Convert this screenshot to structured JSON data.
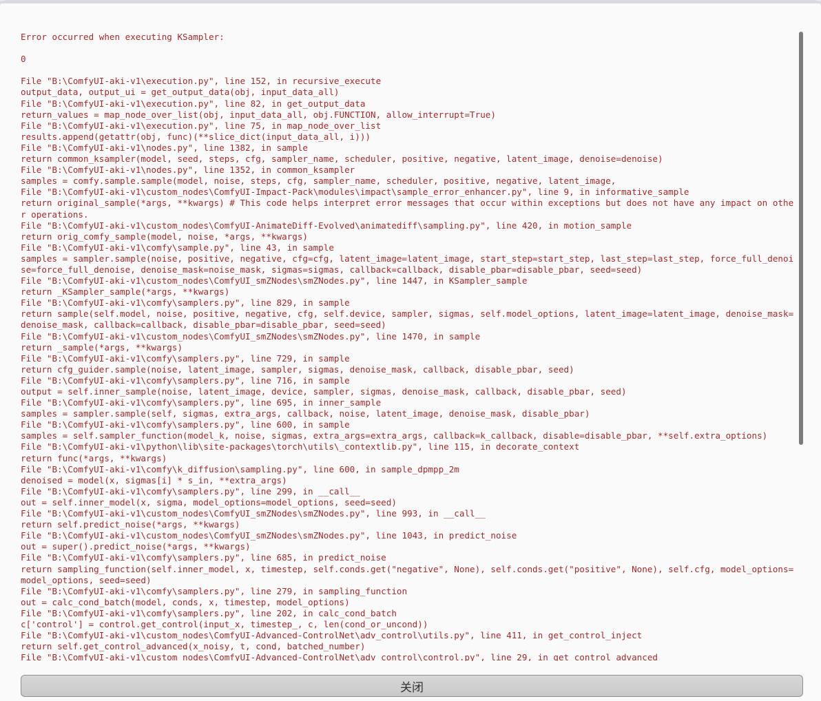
{
  "dialog": {
    "error_title": "Error occurred when executing KSampler:",
    "error_value": "0",
    "traceback": [
      "File \"B:\\ComfyUI-aki-v1\\execution.py\", line 152, in recursive_execute",
      "output_data, output_ui = get_output_data(obj, input_data_all)",
      "File \"B:\\ComfyUI-aki-v1\\execution.py\", line 82, in get_output_data",
      "return_values = map_node_over_list(obj, input_data_all, obj.FUNCTION, allow_interrupt=True)",
      "File \"B:\\ComfyUI-aki-v1\\execution.py\", line 75, in map_node_over_list",
      "results.append(getattr(obj, func)(**slice_dict(input_data_all, i)))",
      "File \"B:\\ComfyUI-aki-v1\\nodes.py\", line 1382, in sample",
      "return common_ksampler(model, seed, steps, cfg, sampler_name, scheduler, positive, negative, latent_image, denoise=denoise)",
      "File \"B:\\ComfyUI-aki-v1\\nodes.py\", line 1352, in common_ksampler",
      "samples = comfy.sample.sample(model, noise, steps, cfg, sampler_name, scheduler, positive, negative, latent_image,",
      "File \"B:\\ComfyUI-aki-v1\\custom_nodes\\ComfyUI-Impact-Pack\\modules\\impact\\sample_error_enhancer.py\", line 9, in informative_sample",
      "return original_sample(*args, **kwargs) # This code helps interpret error messages that occur within exceptions but does not have any impact on other operations.",
      "File \"B:\\ComfyUI-aki-v1\\custom_nodes\\ComfyUI-AnimateDiff-Evolved\\animatediff\\sampling.py\", line 420, in motion_sample",
      "return orig_comfy_sample(model, noise, *args, **kwargs)",
      "File \"B:\\ComfyUI-aki-v1\\comfy\\sample.py\", line 43, in sample",
      "samples = sampler.sample(noise, positive, negative, cfg=cfg, latent_image=latent_image, start_step=start_step, last_step=last_step, force_full_denoise=force_full_denoise, denoise_mask=noise_mask, sigmas=sigmas, callback=callback, disable_pbar=disable_pbar, seed=seed)",
      "File \"B:\\ComfyUI-aki-v1\\custom_nodes\\ComfyUI_smZNodes\\smZNodes.py\", line 1447, in KSampler_sample",
      "return _KSampler_sample(*args, **kwargs)",
      "File \"B:\\ComfyUI-aki-v1\\comfy\\samplers.py\", line 829, in sample",
      "return sample(self.model, noise, positive, negative, cfg, self.device, sampler, sigmas, self.model_options, latent_image=latent_image, denoise_mask=denoise_mask, callback=callback, disable_pbar=disable_pbar, seed=seed)",
      "File \"B:\\ComfyUI-aki-v1\\custom_nodes\\ComfyUI_smZNodes\\smZNodes.py\", line 1470, in sample",
      "return _sample(*args, **kwargs)",
      "File \"B:\\ComfyUI-aki-v1\\comfy\\samplers.py\", line 729, in sample",
      "return cfg_guider.sample(noise, latent_image, sampler, sigmas, denoise_mask, callback, disable_pbar, seed)",
      "File \"B:\\ComfyUI-aki-v1\\comfy\\samplers.py\", line 716, in sample",
      "output = self.inner_sample(noise, latent_image, device, sampler, sigmas, denoise_mask, callback, disable_pbar, seed)",
      "File \"B:\\ComfyUI-aki-v1\\comfy\\samplers.py\", line 695, in inner_sample",
      "samples = sampler.sample(self, sigmas, extra_args, callback, noise, latent_image, denoise_mask, disable_pbar)",
      "File \"B:\\ComfyUI-aki-v1\\comfy\\samplers.py\", line 600, in sample",
      "samples = self.sampler_function(model_k, noise, sigmas, extra_args=extra_args, callback=k_callback, disable=disable_pbar, **self.extra_options)",
      "File \"B:\\ComfyUI-aki-v1\\python\\lib\\site-packages\\torch\\utils\\_contextlib.py\", line 115, in decorate_context",
      "return func(*args, **kwargs)",
      "File \"B:\\ComfyUI-aki-v1\\comfy\\k_diffusion\\sampling.py\", line 600, in sample_dpmpp_2m",
      "denoised = model(x, sigmas[i] * s_in, **extra_args)",
      "File \"B:\\ComfyUI-aki-v1\\comfy\\samplers.py\", line 299, in __call__",
      "out = self.inner_model(x, sigma, model_options=model_options, seed=seed)",
      "File \"B:\\ComfyUI-aki-v1\\custom_nodes\\ComfyUI_smZNodes\\smZNodes.py\", line 993, in __call__",
      "return self.predict_noise(*args, **kwargs)",
      "File \"B:\\ComfyUI-aki-v1\\custom_nodes\\ComfyUI_smZNodes\\smZNodes.py\", line 1043, in predict_noise",
      "out = super().predict_noise(*args, **kwargs)",
      "File \"B:\\ComfyUI-aki-v1\\comfy\\samplers.py\", line 685, in predict_noise",
      "return sampling_function(self.inner_model, x, timestep, self.conds.get(\"negative\", None), self.conds.get(\"positive\", None), self.cfg, model_options=model_options, seed=seed)",
      "File \"B:\\ComfyUI-aki-v1\\comfy\\samplers.py\", line 279, in sampling_function",
      "out = calc_cond_batch(model, conds, x, timestep, model_options)",
      "File \"B:\\ComfyUI-aki-v1\\comfy\\samplers.py\", line 202, in calc_cond_batch",
      "c['control'] = control.get_control(input_x, timestep_, c, len(cond_or_uncond))",
      "File \"B:\\ComfyUI-aki-v1\\custom_nodes\\ComfyUI-Advanced-ControlNet\\adv_control\\utils.py\", line 411, in get_control_inject",
      "return self.get_control_advanced(x_noisy, t, cond, batched_number)",
      "File \"B:\\ComfyUI-aki-v1\\custom_nodes\\ComfyUI-Advanced-ControlNet\\adv_control\\control.py\", line 29, in get_control_advanced"
    ],
    "close_label": "关闭"
  },
  "colors": {
    "error_text": "#a52a2a",
    "background": "#fafafa",
    "button": "#cfcfcf"
  }
}
